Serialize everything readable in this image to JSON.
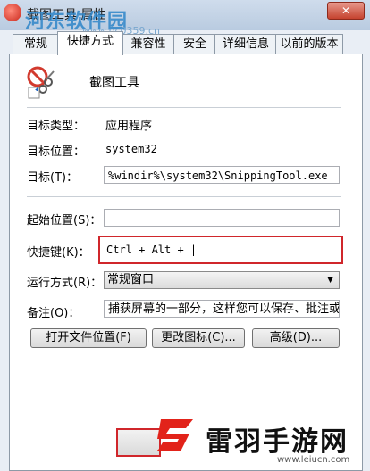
{
  "window": {
    "title": "截图工具 属性",
    "close_glyph": "✕"
  },
  "watermark": {
    "text": "河东软件园",
    "url": "www.pc0359.cn"
  },
  "tabs": [
    {
      "label": "常规",
      "active": false
    },
    {
      "label": "快捷方式",
      "active": true
    },
    {
      "label": "兼容性",
      "active": false
    },
    {
      "label": "安全",
      "active": false
    },
    {
      "label": "详细信息",
      "active": false
    },
    {
      "label": "以前的版本",
      "active": false
    }
  ],
  "header": {
    "name": "截图工具",
    "icon": "snipping-tool-icon"
  },
  "info": {
    "target_type_label": "目标类型：",
    "target_type_value": "应用程序",
    "target_location_label": "目标位置：",
    "target_location_value": "system32",
    "target_label": "目标(T)：",
    "target_value": "%windir%\\system32\\SnippingTool.exe"
  },
  "fields": {
    "start_in_label": "起始位置(S)：",
    "start_in_value": "",
    "shortcut_key_label": "快捷键(K)：",
    "shortcut_key_value": "Ctrl + Alt + |",
    "run_label": "运行方式(R)：",
    "run_value": "常规窗口",
    "comment_label": "备注(O)：",
    "comment_value": "捕获屏幕的一部分，这样您可以保存、批注或"
  },
  "buttons": {
    "open_location": "打开文件位置(F)",
    "change_icon": "更改图标(C)...",
    "advanced": "高级(D)..."
  },
  "brand": {
    "name": "雷羽手游网",
    "url": "www.leiucn.com"
  },
  "colors": {
    "highlight": "#d0262b",
    "accent": "#2f86c9"
  }
}
